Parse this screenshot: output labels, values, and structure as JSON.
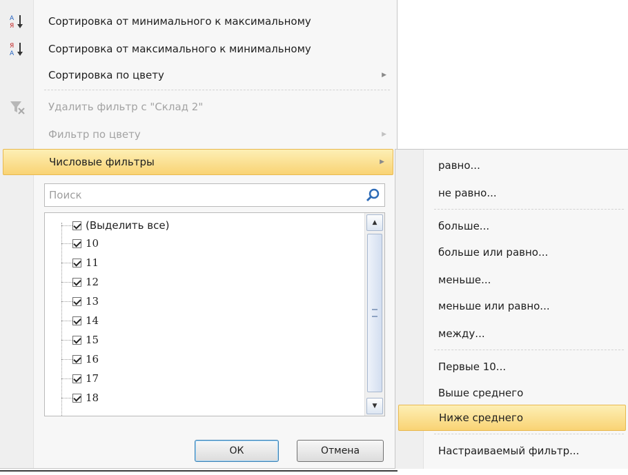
{
  "menu": {
    "sort_asc": "Сортировка от минимального к максимальному",
    "sort_desc": "Сортировка от максимального к минимальному",
    "sort_color": "Сортировка по цвету",
    "clear_filter": "Удалить фильтр с \"Склад 2\"",
    "filter_color": "Фильтр по цвету",
    "number_filters": "Числовые фильтры",
    "icons": {
      "sort_asc": "sort-az-icon",
      "sort_desc": "sort-za-icon",
      "clear_filter": "clear-filter-icon"
    }
  },
  "search": {
    "placeholder": "Поиск",
    "icon": "search-icon"
  },
  "list": {
    "select_all": "(Выделить все)",
    "items": [
      "10",
      "11",
      "12",
      "13",
      "14",
      "15",
      "16",
      "17",
      "18"
    ]
  },
  "buttons": {
    "ok": "ОК",
    "cancel": "Отмена"
  },
  "submenu": {
    "items": [
      "равно...",
      "не равно...",
      "больше...",
      "больше или равно...",
      "меньше...",
      "меньше или равно...",
      "между...",
      "Первые 10...",
      "Выше среднего",
      "Ниже среднего",
      "Настраиваемый фильтр..."
    ],
    "highlighted": "Ниже среднего"
  },
  "colors": {
    "highlight_top": "#fdefb5",
    "highlight_bottom": "#f9d374",
    "highlight_border": "#e8b84f"
  }
}
